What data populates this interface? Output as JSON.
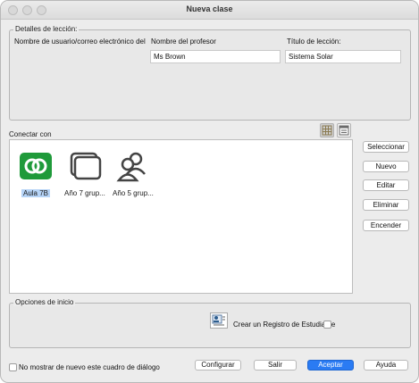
{
  "window": {
    "title": "Nueva clase"
  },
  "lesson_details": {
    "group_title": "Detalles de lección:",
    "username_label": "Nombre de usuario/correo electrónico del",
    "teacher_label": "Nombre del profesor",
    "teacher_value": "Ms Brown",
    "title_label": "Título de lección:",
    "title_value": "Sistema Solar"
  },
  "connect": {
    "label": "Conectar con",
    "tiles": [
      {
        "label": "Aula 7B",
        "icon": "class-link-icon",
        "selected": true
      },
      {
        "label": "Año 7 grup...",
        "icon": "stacked-screens-icon",
        "selected": false
      },
      {
        "label": "Año 5 grup...",
        "icon": "user-group-icon",
        "selected": false
      }
    ]
  },
  "side_buttons": [
    "Seleccionar",
    "Nuevo",
    "Editar",
    "Eliminar",
    "Encender"
  ],
  "startup_options": {
    "group_title": "Opciones de inicio",
    "register_label": "Crear un Registro de Estudiante",
    "register_checked": false
  },
  "footer": {
    "dont_show_label": "No mostrar de nuevo este cuadro de diálogo",
    "dont_show_checked": false,
    "configure": "Configurar",
    "exit": "Salir",
    "accept": "Aceptar",
    "help": "Ayuda"
  },
  "colors": {
    "accent": "#2a7bf3",
    "tile_green": "#1f9a3a",
    "selection": "#b6d4f7"
  }
}
